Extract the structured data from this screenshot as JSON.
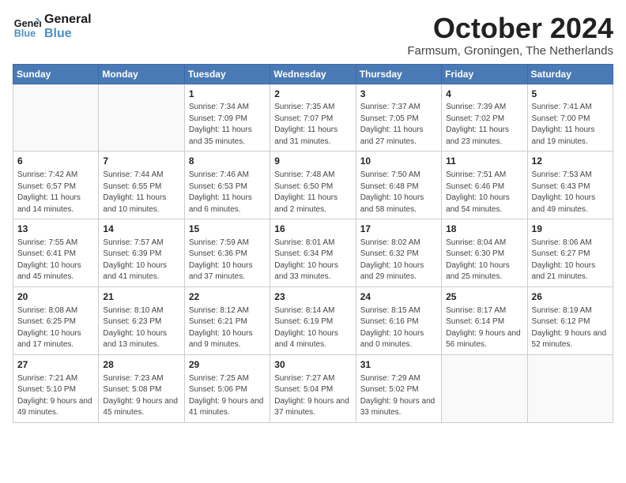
{
  "header": {
    "logo_line1": "General",
    "logo_line2": "Blue",
    "month": "October 2024",
    "location": "Farmsum, Groningen, The Netherlands"
  },
  "weekdays": [
    "Sunday",
    "Monday",
    "Tuesday",
    "Wednesday",
    "Thursday",
    "Friday",
    "Saturday"
  ],
  "weeks": [
    [
      {
        "day": "",
        "info": ""
      },
      {
        "day": "",
        "info": ""
      },
      {
        "day": "1",
        "info": "Sunrise: 7:34 AM\nSunset: 7:09 PM\nDaylight: 11 hours and 35 minutes."
      },
      {
        "day": "2",
        "info": "Sunrise: 7:35 AM\nSunset: 7:07 PM\nDaylight: 11 hours and 31 minutes."
      },
      {
        "day": "3",
        "info": "Sunrise: 7:37 AM\nSunset: 7:05 PM\nDaylight: 11 hours and 27 minutes."
      },
      {
        "day": "4",
        "info": "Sunrise: 7:39 AM\nSunset: 7:02 PM\nDaylight: 11 hours and 23 minutes."
      },
      {
        "day": "5",
        "info": "Sunrise: 7:41 AM\nSunset: 7:00 PM\nDaylight: 11 hours and 19 minutes."
      }
    ],
    [
      {
        "day": "6",
        "info": "Sunrise: 7:42 AM\nSunset: 6:57 PM\nDaylight: 11 hours and 14 minutes."
      },
      {
        "day": "7",
        "info": "Sunrise: 7:44 AM\nSunset: 6:55 PM\nDaylight: 11 hours and 10 minutes."
      },
      {
        "day": "8",
        "info": "Sunrise: 7:46 AM\nSunset: 6:53 PM\nDaylight: 11 hours and 6 minutes."
      },
      {
        "day": "9",
        "info": "Sunrise: 7:48 AM\nSunset: 6:50 PM\nDaylight: 11 hours and 2 minutes."
      },
      {
        "day": "10",
        "info": "Sunrise: 7:50 AM\nSunset: 6:48 PM\nDaylight: 10 hours and 58 minutes."
      },
      {
        "day": "11",
        "info": "Sunrise: 7:51 AM\nSunset: 6:46 PM\nDaylight: 10 hours and 54 minutes."
      },
      {
        "day": "12",
        "info": "Sunrise: 7:53 AM\nSunset: 6:43 PM\nDaylight: 10 hours and 49 minutes."
      }
    ],
    [
      {
        "day": "13",
        "info": "Sunrise: 7:55 AM\nSunset: 6:41 PM\nDaylight: 10 hours and 45 minutes."
      },
      {
        "day": "14",
        "info": "Sunrise: 7:57 AM\nSunset: 6:39 PM\nDaylight: 10 hours and 41 minutes."
      },
      {
        "day": "15",
        "info": "Sunrise: 7:59 AM\nSunset: 6:36 PM\nDaylight: 10 hours and 37 minutes."
      },
      {
        "day": "16",
        "info": "Sunrise: 8:01 AM\nSunset: 6:34 PM\nDaylight: 10 hours and 33 minutes."
      },
      {
        "day": "17",
        "info": "Sunrise: 8:02 AM\nSunset: 6:32 PM\nDaylight: 10 hours and 29 minutes."
      },
      {
        "day": "18",
        "info": "Sunrise: 8:04 AM\nSunset: 6:30 PM\nDaylight: 10 hours and 25 minutes."
      },
      {
        "day": "19",
        "info": "Sunrise: 8:06 AM\nSunset: 6:27 PM\nDaylight: 10 hours and 21 minutes."
      }
    ],
    [
      {
        "day": "20",
        "info": "Sunrise: 8:08 AM\nSunset: 6:25 PM\nDaylight: 10 hours and 17 minutes."
      },
      {
        "day": "21",
        "info": "Sunrise: 8:10 AM\nSunset: 6:23 PM\nDaylight: 10 hours and 13 minutes."
      },
      {
        "day": "22",
        "info": "Sunrise: 8:12 AM\nSunset: 6:21 PM\nDaylight: 10 hours and 9 minutes."
      },
      {
        "day": "23",
        "info": "Sunrise: 8:14 AM\nSunset: 6:19 PM\nDaylight: 10 hours and 4 minutes."
      },
      {
        "day": "24",
        "info": "Sunrise: 8:15 AM\nSunset: 6:16 PM\nDaylight: 10 hours and 0 minutes."
      },
      {
        "day": "25",
        "info": "Sunrise: 8:17 AM\nSunset: 6:14 PM\nDaylight: 9 hours and 56 minutes."
      },
      {
        "day": "26",
        "info": "Sunrise: 8:19 AM\nSunset: 6:12 PM\nDaylight: 9 hours and 52 minutes."
      }
    ],
    [
      {
        "day": "27",
        "info": "Sunrise: 7:21 AM\nSunset: 5:10 PM\nDaylight: 9 hours and 49 minutes."
      },
      {
        "day": "28",
        "info": "Sunrise: 7:23 AM\nSunset: 5:08 PM\nDaylight: 9 hours and 45 minutes."
      },
      {
        "day": "29",
        "info": "Sunrise: 7:25 AM\nSunset: 5:06 PM\nDaylight: 9 hours and 41 minutes."
      },
      {
        "day": "30",
        "info": "Sunrise: 7:27 AM\nSunset: 5:04 PM\nDaylight: 9 hours and 37 minutes."
      },
      {
        "day": "31",
        "info": "Sunrise: 7:29 AM\nSunset: 5:02 PM\nDaylight: 9 hours and 33 minutes."
      },
      {
        "day": "",
        "info": ""
      },
      {
        "day": "",
        "info": ""
      }
    ]
  ]
}
